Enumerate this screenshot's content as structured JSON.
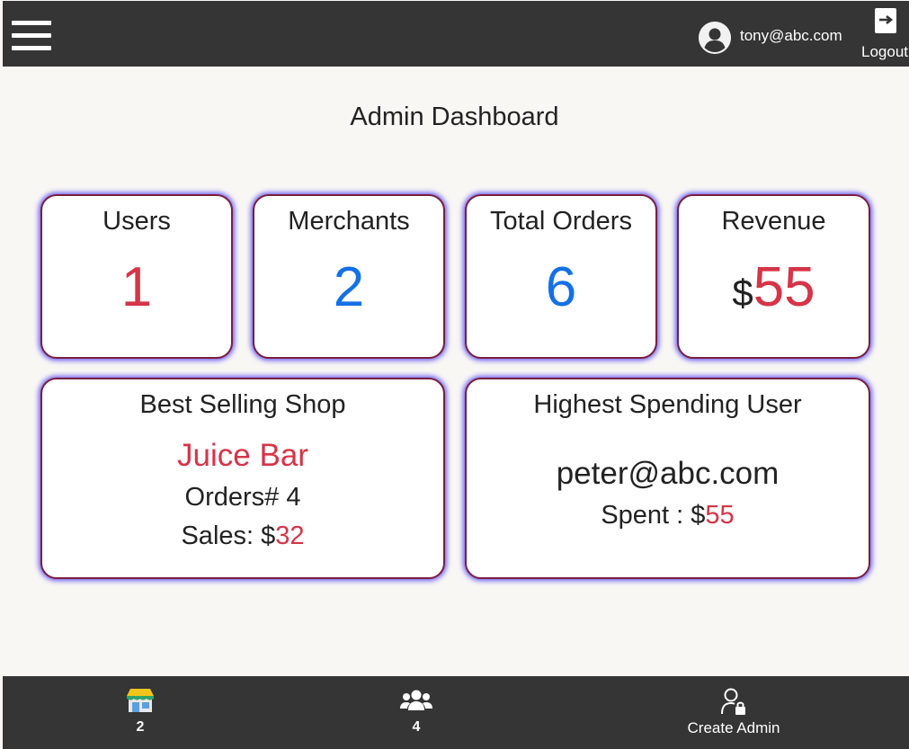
{
  "header": {
    "user_email": "tony@abc.com",
    "logout_label": "Logout"
  },
  "page_title": "Admin Dashboard",
  "stats": {
    "users": {
      "label": "Users",
      "value": "1"
    },
    "merchants": {
      "label": "Merchants",
      "value": "2"
    },
    "orders": {
      "label": "Total Orders",
      "value": "6"
    },
    "revenue": {
      "label": "Revenue",
      "currency": "$",
      "value": "55"
    }
  },
  "best_shop": {
    "title": "Best Selling Shop",
    "name": "Juice Bar",
    "orders_line": "Orders# 4",
    "sales_prefix": "Sales: $",
    "sales_value": "32"
  },
  "top_user": {
    "title": "Highest Spending User",
    "email": "peter@abc.com",
    "spent_prefix": "Spent : $",
    "spent_value": "55"
  },
  "bottom_nav": {
    "shops_count": "2",
    "users_count": "4",
    "create_admin_label": "Create Admin"
  },
  "colors": {
    "header_bg": "#353535",
    "accent_red": "#d63447",
    "accent_blue": "#1570e6",
    "card_border": "#7a1e3f",
    "card_glow": "#6b5cf0"
  },
  "icons": {
    "menu": "hamburger-icon",
    "avatar": "user-circle-icon",
    "logout": "logout-icon",
    "shops": "store-icon",
    "users": "users-group-icon",
    "create_admin": "user-lock-icon"
  }
}
